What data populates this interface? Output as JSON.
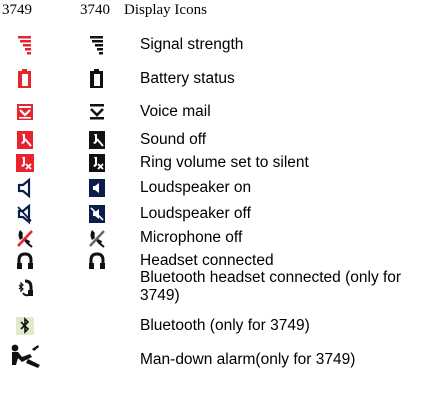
{
  "header": {
    "col1": "3749",
    "col2": "3740",
    "col3": "Display Icons"
  },
  "colors": {
    "red_variant": "#e8232e",
    "black_variant": "#111111",
    "bluetooth_green": "#dfeccb"
  },
  "rows": [
    {
      "label": "Signal strength",
      "icon_3749": "signal-strength-icon-red",
      "icon_3740": "signal-strength-icon-black"
    },
    {
      "label": "Battery status",
      "icon_3749": "battery-icon-red",
      "icon_3740": "battery-icon-black"
    },
    {
      "label": "Voice mail",
      "icon_3749": "voice-mail-icon-red",
      "icon_3740": "voice-mail-icon-black"
    },
    {
      "label": "Sound off",
      "icon_3749": "sound-off-icon-red",
      "icon_3740": "sound-off-icon-black"
    },
    {
      "label": "Ring volume set to silent",
      "icon_3749": "ring-silent-icon-red",
      "icon_3740": "ring-silent-icon-black"
    },
    {
      "label": "Loudspeaker on",
      "icon_3749": "loudspeaker-on-icon",
      "icon_3740": "loudspeaker-on-icon-filled"
    },
    {
      "label": "Loudspeaker off",
      "icon_3749": "loudspeaker-off-icon",
      "icon_3740": "loudspeaker-off-icon-filled"
    },
    {
      "label": "Microphone off",
      "icon_3749": "microphone-off-icon",
      "icon_3740": "microphone-off-icon-black"
    },
    {
      "label": "Headset connected",
      "icon_3749": "headset-icon",
      "icon_3740": "headset-icon-black"
    },
    {
      "label": "Bluetooth headset connected (only for 3749)",
      "icon_3749": "bluetooth-headset-icon"
    },
    {
      "label": "Bluetooth (only for 3749)",
      "icon_3749": "bluetooth-icon"
    },
    {
      "label": "Man-down alarm(only for 3749)",
      "icon_3749": "man-down-alarm-icon"
    }
  ]
}
